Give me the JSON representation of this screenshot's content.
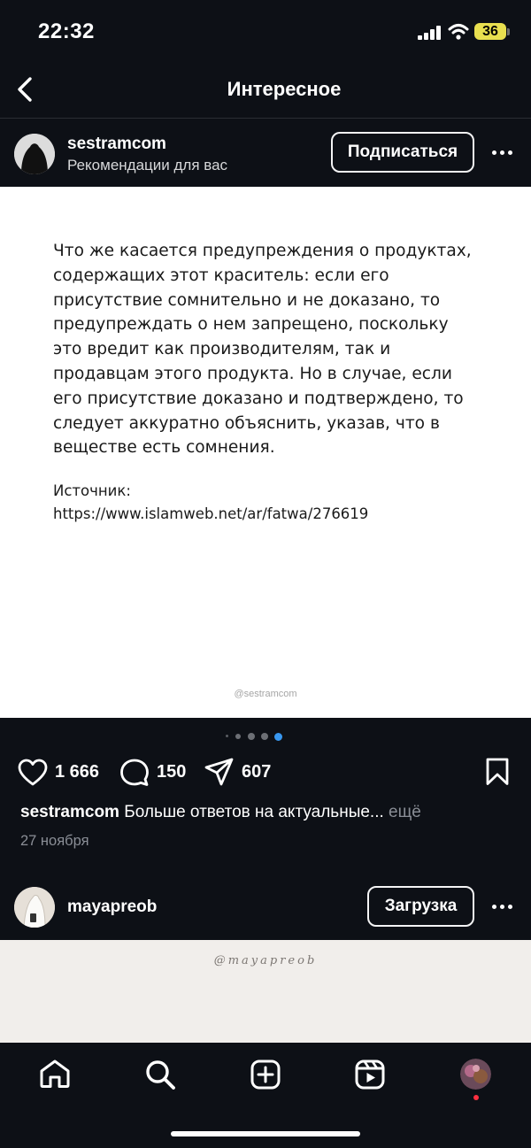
{
  "status_bar": {
    "time": "22:32",
    "battery": "36"
  },
  "header": {
    "title": "Интересное"
  },
  "post": {
    "username": "sestramcom",
    "subtitle": "Рекомендации для вас",
    "follow_label": "Подписаться",
    "text": "Что же касается предупреждения о продуктах, содержащих этот краситель: если его присутствие сомнительно и не доказано, то предупреждать о нем запрещено, поскольку это вредит как производителям, так и продавцам этого продукта. Но в случае, если его присутствие доказано и подтверждено, то следует аккуратно объяснить, указав, что в веществе есть сомнения.",
    "source_label": "Источник:",
    "source_url": "https://www.islamweb.net/ar/fatwa/276619",
    "watermark": "@sestramcom",
    "carousel": {
      "count": 4,
      "active": 4
    },
    "likes": "1 666",
    "comments": "150",
    "shares": "607",
    "caption_user": "sestramcom",
    "caption_text": "Больше ответов на актуальные...",
    "caption_more": "ещё",
    "date": "27 ноября"
  },
  "next_post": {
    "username": "mayapreob",
    "button_label": "Загрузка",
    "watermark": "@mayapreob"
  },
  "tabbar": {
    "items": [
      "home-icon",
      "search-icon",
      "create-icon",
      "reels-icon",
      "profile-avatar"
    ],
    "notification_color": "#ff3040"
  },
  "colors": {
    "background": "#0d1016",
    "accent_dot": "#3897f0",
    "battery": "#e8df4f"
  }
}
